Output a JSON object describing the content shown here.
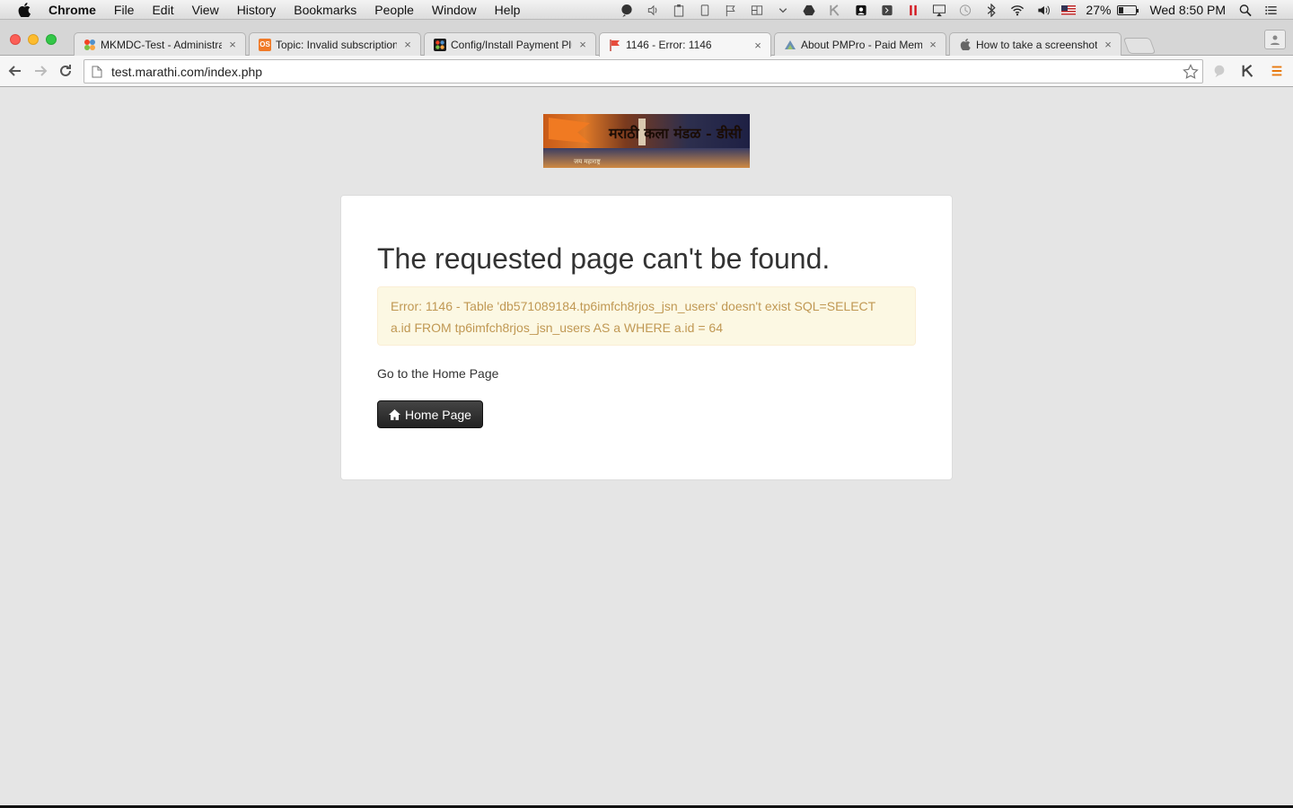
{
  "menubar": {
    "app_name": "Chrome",
    "items": [
      "File",
      "Edit",
      "View",
      "History",
      "Bookmarks",
      "People",
      "Window",
      "Help"
    ],
    "battery_percent": "27%",
    "battery_level": 0.27,
    "clock": "Wed 8:50 PM"
  },
  "tabs": [
    {
      "title": "MKMDC-Test - Administrat",
      "favicon": "joomla-icon",
      "color": "#f44321",
      "active": false
    },
    {
      "title": "Topic: Invalid subscription",
      "favicon": "os-icon",
      "color": "#f07a28",
      "active": false
    },
    {
      "title": "Config/Install Payment Plug",
      "favicon": "joomla-icon",
      "color": "#1a1a1a",
      "active": false
    },
    {
      "title": "1146 - Error: 1146",
      "favicon": "flag-icon",
      "color": "#e74c3c",
      "active": true
    },
    {
      "title": "About PMPro - Paid Memb",
      "favicon": "pmpro-icon",
      "color": "#6a8fb3",
      "active": false
    },
    {
      "title": "How to take a screenshot c",
      "favicon": "apple-icon",
      "color": "#666666",
      "active": false
    }
  ],
  "toolbar": {
    "url": "test.marathi.com/index.php"
  },
  "banner": {
    "title": "मराठी कला मंडळ - डीसी",
    "subtitle": "जय महाराष्ट्र"
  },
  "error": {
    "heading": "The requested page can't be found.",
    "message_line1": "Error: 1146 - Table 'db571089184.tp6imfch8rjos_jsn_users' doesn't exist SQL=SELECT",
    "message_line2": "a.id FROM tp6imfch8rjos_jsn_users AS a WHERE a.id = 64",
    "goto_text": "Go to the Home Page",
    "home_button": "Home Page"
  },
  "colors": {
    "page_bg": "#e5e5e5",
    "alert_bg": "#fcf8e3",
    "alert_text": "#c09853",
    "button_bg": "#222222"
  }
}
